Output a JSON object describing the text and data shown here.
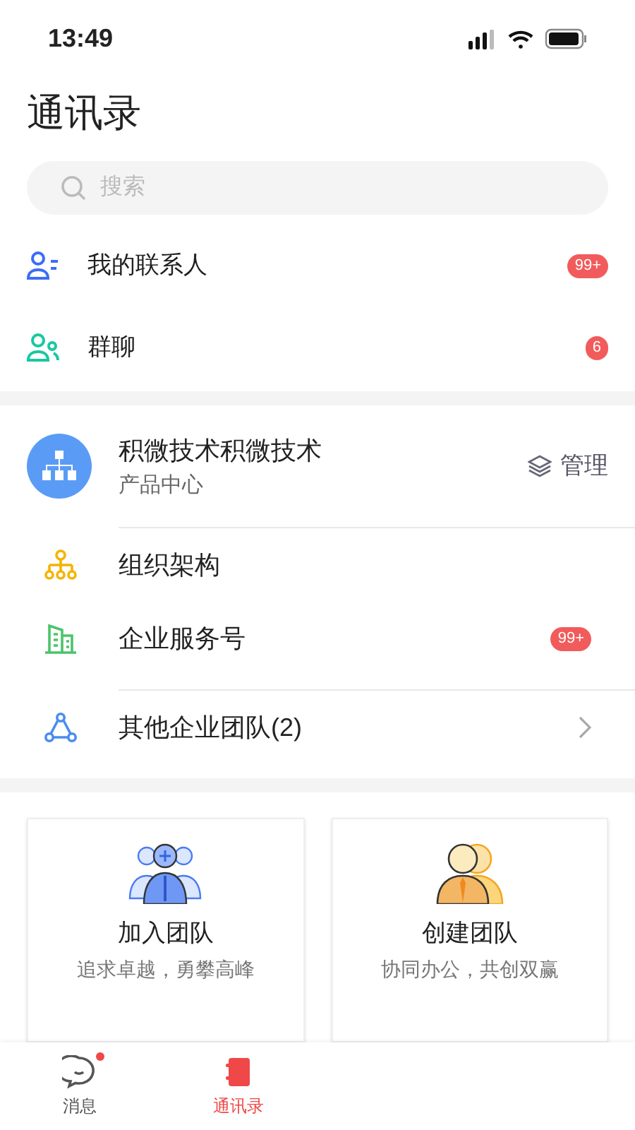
{
  "status_bar": {
    "time": "13:49"
  },
  "title": "通讯录",
  "search": {
    "placeholder": "搜索"
  },
  "contact_items": [
    {
      "kind": "contacts",
      "label": "我的联系人",
      "badge": "99+"
    },
    {
      "kind": "groups",
      "label": "群聊",
      "badge": "6"
    }
  ],
  "organization": {
    "name": "积微技术积微技术",
    "department": "产品中心",
    "manage": "管理"
  },
  "org_items": [
    {
      "kind": "structure",
      "label": "组织架构"
    },
    {
      "kind": "service",
      "label": "企业服务号",
      "badge": "99+"
    },
    {
      "kind": "teams",
      "label": "其他企业团队(2)",
      "chevron": true
    }
  ],
  "cards": [
    {
      "kind": "join",
      "title": "加入团队",
      "subtitle": "追求卓越，勇攀高峰"
    },
    {
      "kind": "create",
      "title": "创建团队",
      "subtitle": "协同办公，共创双赢"
    }
  ],
  "tab_bar": [
    {
      "kind": "chat",
      "label": "消息",
      "selected": false,
      "dot": true
    },
    {
      "kind": "contacts",
      "label": "通讯录",
      "selected": true,
      "dot": false
    }
  ]
}
